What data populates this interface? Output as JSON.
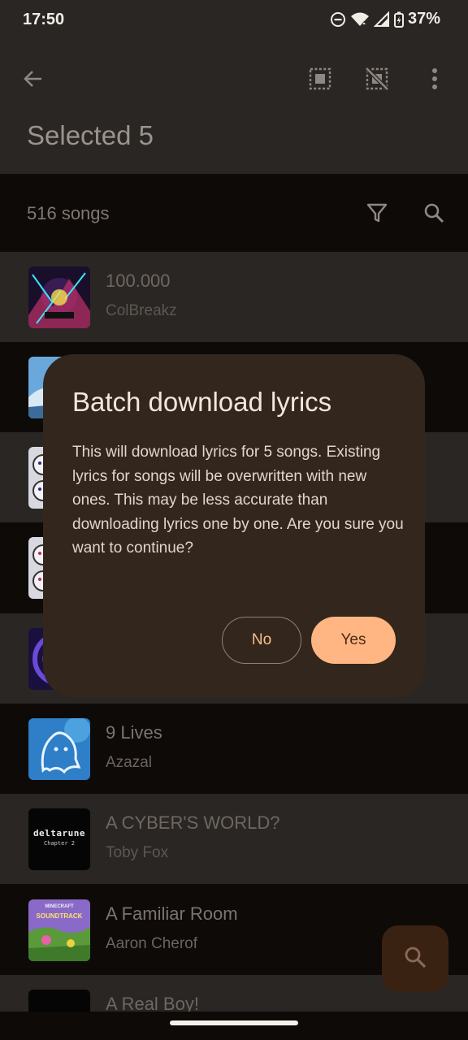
{
  "status_bar": {
    "time": "17:50",
    "battery_percent": "37%",
    "icons": [
      "do-not-disturb-icon",
      "wifi-icon",
      "signal-icon",
      "battery-charging-icon"
    ]
  },
  "app_bar": {
    "title": "Selected 5",
    "actions": [
      "back-arrow-icon",
      "select-all-icon",
      "deselect-all-icon",
      "more-vert-icon"
    ]
  },
  "songs_header": {
    "count_label": "516 songs",
    "actions": [
      "filter-icon",
      "search-icon"
    ]
  },
  "songs": [
    {
      "title": "100.000",
      "artist": "ColBreakz",
      "selected": true,
      "art": "neon-album-art"
    },
    {
      "title": "",
      "artist": "",
      "selected": false,
      "art": "blue-sky-album-art"
    },
    {
      "title": "",
      "artist": "",
      "selected": true,
      "art": "cartoon-album-art"
    },
    {
      "title": "",
      "artist": "",
      "selected": false,
      "art": "cartoon-album-art"
    },
    {
      "title": "",
      "artist": "",
      "selected": true,
      "art": "purple-swirl-album-art"
    },
    {
      "title": "9 Lives",
      "artist": "Azazal",
      "selected": false,
      "art": "ghost-album-art"
    },
    {
      "title": "A CYBER'S WORLD?",
      "artist": "Toby Fox",
      "selected": true,
      "art": "deltarune-album-art"
    },
    {
      "title": "A Familiar Room",
      "artist": "Aaron Cherof",
      "selected": false,
      "art": "minecraft-album-art"
    },
    {
      "title": "A Real Boy!",
      "artist": "",
      "selected": true,
      "art": "dark-album-art"
    }
  ],
  "deltarune_art": {
    "line1": "deltarune",
    "line2": "Chapter 2"
  },
  "minecraft_art": {
    "line1": "MINECRAFT",
    "line2": "SOUNDTRACK"
  },
  "dialog": {
    "title": "Batch download lyrics",
    "body": "This will download lyrics for 5 songs. Existing lyrics for songs will be overwritten with new ones. This may be less accurate than downloading lyrics one by one. Are you sure you want to continue?",
    "no_label": "No",
    "yes_label": "Yes"
  },
  "fab": {
    "icon": "search-icon"
  },
  "colors": {
    "surface": "#2a2623",
    "background": "#0e0a08",
    "dialog": "#33261c",
    "accent": "#ffb682"
  }
}
